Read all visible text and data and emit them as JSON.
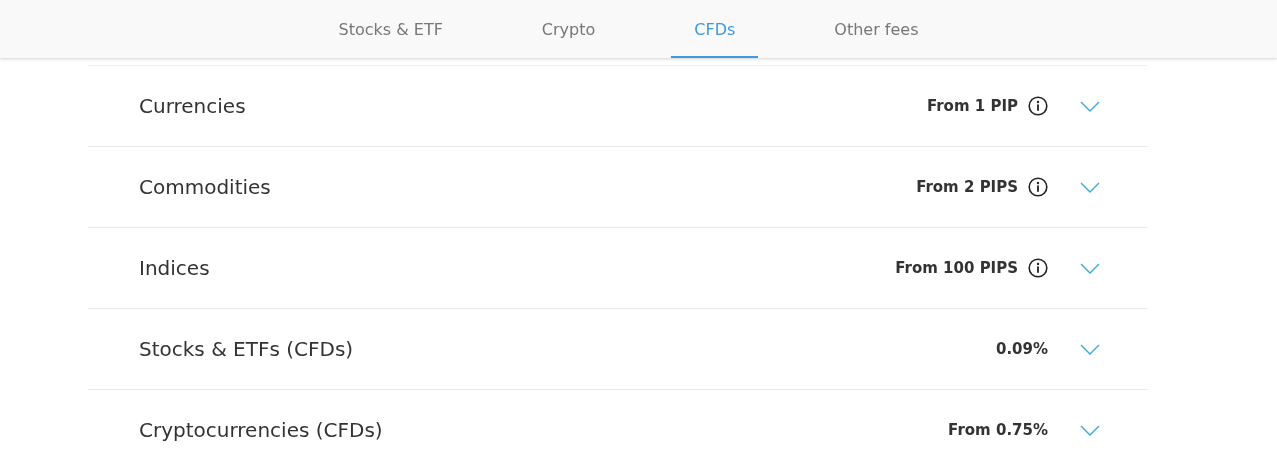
{
  "tabs": [
    {
      "label": "Stocks & ETF",
      "selected": false
    },
    {
      "label": "Crypto",
      "selected": false
    },
    {
      "label": "CFDs",
      "selected": true
    },
    {
      "label": "Other fees",
      "selected": false
    }
  ],
  "fee_rows": [
    {
      "label": "Currencies",
      "value": "From 1 PIP",
      "info_icon": true,
      "expanded": false
    },
    {
      "label": "Commodities",
      "value": "From 2 PIPS",
      "info_icon": true,
      "expanded": false
    },
    {
      "label": "Indices",
      "value": "From 100 PIPS",
      "info_icon": true,
      "expanded": false
    },
    {
      "label": "Stocks & ETFs (CFDs)",
      "value": "0.09%",
      "info_icon": false,
      "expanded": false
    },
    {
      "label": "Cryptocurrencies (CFDs)",
      "value": "From 0.75%",
      "info_icon": false,
      "expanded": false
    }
  ]
}
